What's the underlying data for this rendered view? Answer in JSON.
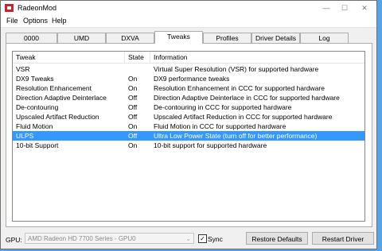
{
  "window": {
    "title": "RadeonMod"
  },
  "menu": [
    "File",
    "Options",
    "Help"
  ],
  "tabs": [
    "0000",
    "UMD",
    "DXVA",
    "Tweaks",
    "Profiles",
    "Driver Details",
    "Log"
  ],
  "active_tab": "Tweaks",
  "list": {
    "columns": [
      "Tweak",
      "State",
      "Information"
    ],
    "rows": [
      {
        "tweak": "VSR",
        "state": "",
        "info": "Virtual Super Resolution (VSR) for supported hardware"
      },
      {
        "tweak": "DX9 Tweaks",
        "state": "On",
        "info": "DX9 performance tweaks"
      },
      {
        "tweak": "Resolution Enhancement",
        "state": "On",
        "info": "Resolution Enhancement in CCC for supported hardware"
      },
      {
        "tweak": "Direction Adaptive Deinterlace",
        "state": "Off",
        "info": "Direction Adaptive Deinterlace in CCC for supported hardware"
      },
      {
        "tweak": "De-contouring",
        "state": "Off",
        "info": "De-contouring in CCC for supported hardware"
      },
      {
        "tweak": "Upscaled Artifact Reduction",
        "state": "Off",
        "info": "Upscaled Artifact Reduction in CCC for supported hardware"
      },
      {
        "tweak": "Fluid Motion",
        "state": "On",
        "info": "Fluid Motion in CCC for supported hardware"
      },
      {
        "tweak": "ULPS",
        "state": "Off",
        "info": "Ultra Low Power State (turn off for better performance)"
      },
      {
        "tweak": "10-bit Support",
        "state": "On",
        "info": "10-bit support for supported hardware"
      }
    ],
    "selected_row": "ULPS"
  },
  "footer": {
    "gpu_label": "GPU:",
    "gpu_value": "AMD Radeon HD 7700 Series - GPU0",
    "sync_label": "Sync",
    "sync_checked": true,
    "restore_defaults": "Restore Defaults",
    "restart_driver": "Restart Driver"
  },
  "colors": {
    "selection": "#3399ff",
    "desktop": "#5aa2e6",
    "app_icon": "#c0282d"
  },
  "icons": {
    "minimize": "—",
    "maximize": "☐",
    "close": "✕",
    "dropdown": "⌄",
    "check": "✓"
  }
}
